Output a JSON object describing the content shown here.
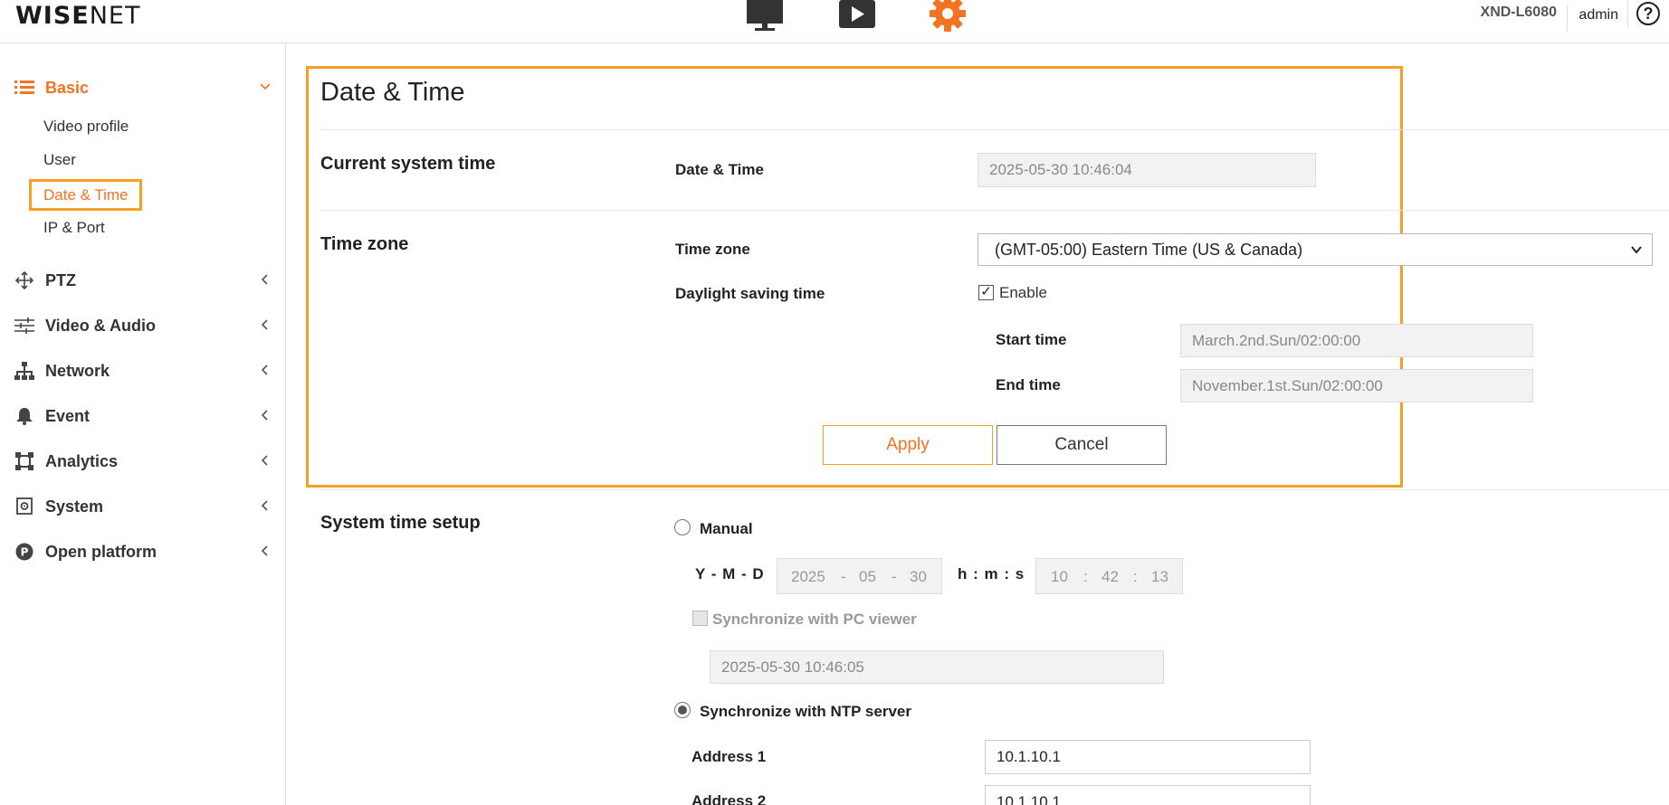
{
  "header": {
    "logo_bold": "WISE",
    "logo_light": "NET",
    "model": "XND-L6080",
    "user": "admin",
    "help": "?"
  },
  "sidebar": {
    "basic": {
      "label": "Basic",
      "subitems": [
        "Video profile",
        "User",
        "Date & Time",
        "IP & Port"
      ]
    },
    "items": [
      "PTZ",
      "Video & Audio",
      "Network",
      "Event",
      "Analytics",
      "System",
      "Open platform"
    ]
  },
  "page": {
    "title": "Date & Time",
    "current_system_time": {
      "section": "Current system time",
      "label": "Date & Time",
      "value": "2025-05-30 10:46:04"
    },
    "time_zone": {
      "section": "Time zone",
      "label": "Time zone",
      "selected": "(GMT-05:00) Eastern Time (US & Canada)",
      "dst_label": "Daylight saving time",
      "dst_enable": "Enable",
      "start_label": "Start time",
      "start_value": "March.2nd.Sun/02:00:00",
      "end_label": "End time",
      "end_value": "November.1st.Sun/02:00:00"
    },
    "buttons": {
      "apply": "Apply",
      "cancel": "Cancel"
    },
    "system_time_setup": {
      "section": "System time setup",
      "manual": "Manual",
      "ymd_label": "Y - M - D",
      "year": "2025",
      "month": "05",
      "day": "30",
      "date_sep": "-",
      "hms_label": "h : m : s",
      "hour": "10",
      "minute": "42",
      "second": "13",
      "time_sep": ":",
      "sync_pc": "Synchronize with PC viewer",
      "pc_time": "2025-05-30 10:46:05",
      "sync_ntp": "Synchronize with NTP server",
      "address1_label": "Address 1",
      "address1": "10.1.10.1",
      "address2_label": "Address 2",
      "address2": "10.1.10.1"
    }
  },
  "colors": {
    "accent": "#f37321",
    "highlight": "#f5a023"
  }
}
